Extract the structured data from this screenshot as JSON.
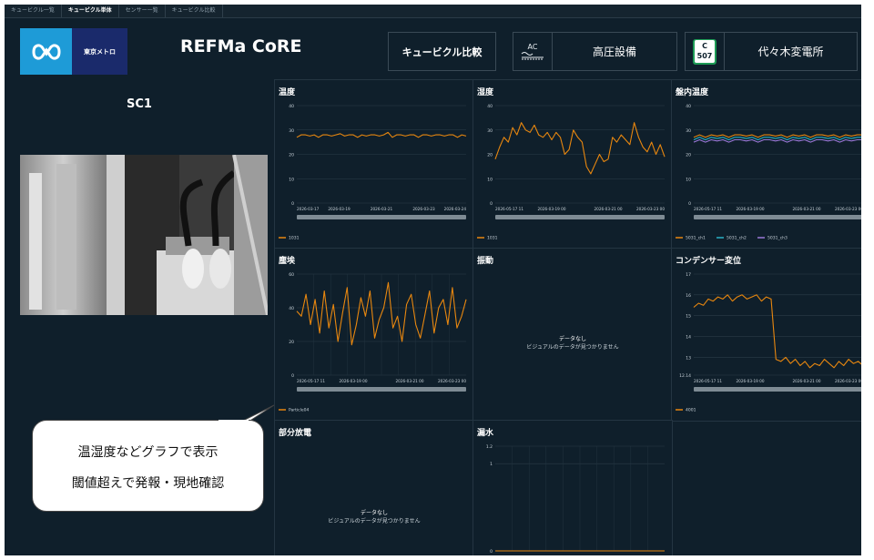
{
  "tabs": [
    "キュービクル一覧",
    "キュービクル単体",
    "センサー一覧",
    "キュービクル比較"
  ],
  "header": {
    "logo_text": "東京メトロ",
    "title": "REFMa CoRE",
    "compare_button": "キュービクル比較",
    "hv_label": "高圧設備",
    "ac_icon_text": "AC",
    "substation_label": "代々木変電所",
    "badge_top": "C",
    "badge_bottom": "507"
  },
  "left": {
    "unit_label": "SC1"
  },
  "callout": {
    "line1": "温湿度などグラフで表示",
    "line2": "閾値超えで発報・現地確認"
  },
  "no_data": {
    "title": "データなし",
    "message": "ビジュアルのデータが見つかりません"
  },
  "colors": {
    "orange": "#e8870f",
    "teal": "#2ab2c6",
    "purple": "#9a78d8",
    "background": "#0f1f2b"
  },
  "chart_data": [
    {
      "id": "temperature",
      "type": "line",
      "title": "温度",
      "ylim": [
        0,
        40
      ],
      "yticks": [
        0,
        10,
        20,
        30,
        40
      ],
      "xticks": [
        "2026-03-17",
        "2026-03-19",
        "2026-03-21",
        "2026-03-23",
        "2026-03-24"
      ],
      "series": [
        {
          "name": "1031",
          "color": "#e8870f",
          "values": [
            27,
            28,
            28,
            27.5,
            28,
            27,
            28,
            28,
            27.5,
            28,
            28.5,
            27.5,
            28,
            28,
            27,
            28,
            27.5,
            28,
            28,
            27.5,
            28,
            29,
            27,
            28,
            28,
            27.5,
            28,
            28,
            27,
            28,
            28,
            27.5,
            28,
            28,
            27.5,
            28,
            28,
            27,
            28,
            27.5
          ]
        }
      ],
      "legend": "bottom"
    },
    {
      "id": "humidity",
      "type": "line",
      "title": "湿度",
      "ylim": [
        0,
        40
      ],
      "yticks": [
        0,
        10,
        20,
        30,
        40
      ],
      "xticks": [
        "2026-05-17 11",
        "2026-03-19 00",
        "2026-03-21 00",
        "2026-03-23 00"
      ],
      "series": [
        {
          "name": "1031",
          "color": "#e8870f",
          "values": [
            18,
            23,
            27,
            25,
            31,
            28,
            33,
            30,
            29,
            32,
            28,
            27,
            29,
            26,
            29,
            27,
            20,
            22,
            30,
            27,
            25,
            15,
            12,
            16,
            20,
            17,
            18,
            27,
            25,
            28,
            26,
            24,
            33,
            27,
            23,
            21,
            25,
            20,
            24,
            19
          ]
        }
      ],
      "legend": "bottom"
    },
    {
      "id": "panel-temperature",
      "type": "line",
      "title": "盤内温度",
      "ylim": [
        0,
        40
      ],
      "yticks": [
        0,
        10,
        20,
        30,
        40
      ],
      "xticks": [
        "2026-05-17 11",
        "2026-03-19 00",
        "2026-03-21 00",
        "2026-03-23 00"
      ],
      "series": [
        {
          "name": "5031_ch1",
          "color": "#e8870f",
          "values": [
            27,
            28,
            27,
            28,
            27.5,
            28,
            27,
            28,
            28,
            27.5,
            28,
            27,
            28,
            28,
            27.5,
            28,
            27,
            28,
            27.5,
            28,
            27,
            28,
            28,
            27.5,
            28,
            27,
            28,
            27.5,
            28,
            28
          ]
        },
        {
          "name": "5031_ch2",
          "color": "#2ab2c6",
          "values": [
            26,
            27,
            26,
            27,
            26.5,
            27,
            26,
            27,
            27,
            26.5,
            27,
            26,
            27,
            27,
            26.5,
            27,
            26,
            27,
            26.5,
            27,
            26,
            27,
            27,
            26.5,
            27,
            26,
            27,
            26.5,
            27,
            27
          ]
        },
        {
          "name": "5031_ch3",
          "color": "#9a78d8",
          "values": [
            25,
            26,
            25,
            26,
            25.5,
            26,
            25,
            26,
            26,
            25.5,
            26,
            25,
            26,
            26,
            25.5,
            26,
            25,
            26,
            25.5,
            26,
            25,
            26,
            26,
            25.5,
            26,
            25,
            26,
            25.5,
            26,
            26
          ]
        }
      ],
      "legend": "bottom"
    },
    {
      "id": "dust",
      "type": "line",
      "title": "塵埃",
      "ylim": [
        0,
        60
      ],
      "yticks": [
        0,
        20,
        40,
        60
      ],
      "xticks": [
        "2026-05-17 11",
        "2026-03-19 00",
        "2026-03-21 00",
        "2026-03-23 00"
      ],
      "series": [
        {
          "name": "Particle04",
          "color": "#e8870f",
          "values": [
            38,
            35,
            48,
            30,
            45,
            25,
            50,
            28,
            42,
            20,
            37,
            52,
            18,
            30,
            46,
            35,
            50,
            22,
            33,
            40,
            55,
            28,
            35,
            20,
            42,
            48,
            30,
            22,
            36,
            50,
            25,
            40,
            45,
            30,
            52,
            28,
            35,
            45
          ]
        }
      ],
      "legend": "bottom"
    },
    {
      "id": "vibration",
      "type": "line",
      "title": "振動",
      "no_data": true
    },
    {
      "id": "capacitor-displacement",
      "type": "line",
      "title": "コンデンサー変位",
      "ylim": [
        12.14,
        17
      ],
      "yticks": [
        12.14,
        13,
        14,
        15,
        16,
        17
      ],
      "xticks": [
        "2026-05-17 11",
        "2026-03-19 00",
        "2026-03-21 00",
        "2026-03-23 00"
      ],
      "series": [
        {
          "name": "4001",
          "color": "#e8870f",
          "values": [
            15.4,
            15.6,
            15.5,
            15.8,
            15.7,
            15.9,
            15.8,
            16.0,
            15.7,
            15.9,
            16.0,
            15.8,
            15.9,
            16.0,
            15.7,
            15.9,
            15.8,
            12.9,
            12.8,
            13.0,
            12.7,
            12.9,
            12.6,
            12.8,
            12.5,
            12.7,
            12.6,
            12.9,
            12.7,
            12.5,
            12.8,
            12.6,
            12.9,
            12.7,
            12.8,
            12.6
          ]
        }
      ],
      "legend": "bottom"
    },
    {
      "id": "partial-discharge",
      "type": "line",
      "title": "部分放電",
      "no_data": true
    },
    {
      "id": "water-leak",
      "type": "line",
      "title": "漏水",
      "ylim": [
        0,
        1.2
      ],
      "yticks": [
        0,
        1,
        1.2
      ],
      "series": [
        {
          "name": "",
          "color": "#e8870f",
          "values": [
            0,
            0,
            0,
            0,
            0,
            0,
            0,
            0,
            0,
            0
          ]
        }
      ]
    }
  ]
}
